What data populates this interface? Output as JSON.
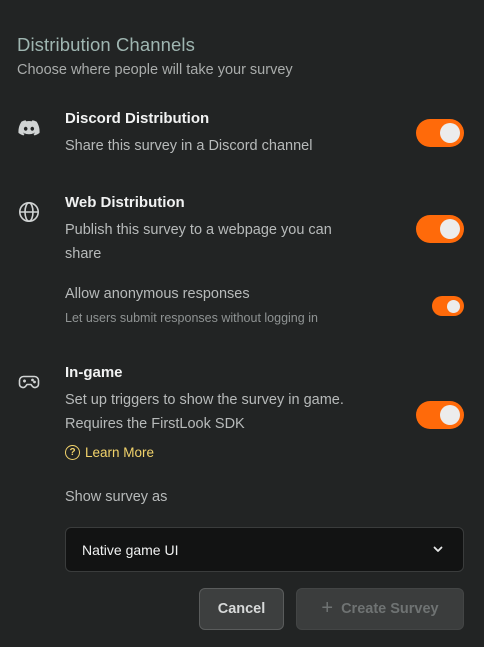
{
  "header": {
    "title": "Distribution Channels",
    "subtitle": "Choose where people will take your survey"
  },
  "discord": {
    "icon": "discord-icon",
    "title": "Discord Distribution",
    "description": "Share this survey in a Discord channel",
    "enabled": true
  },
  "web": {
    "icon": "globe-icon",
    "title": "Web Distribution",
    "description": "Publish this survey to a webpage you can share",
    "enabled": true,
    "anonymous": {
      "label": "Allow anonymous responses",
      "description": "Let users submit responses without logging in",
      "enabled": true
    }
  },
  "ingame": {
    "icon": "gamepad-icon",
    "title": "In-game",
    "description": "Set up triggers to show the survey in game. Requires the FirstLook SDK",
    "enabled": true,
    "learn_more": "Learn More",
    "show_as_label": "Show survey as",
    "show_as_value": "Native game UI"
  },
  "actions": {
    "cancel": "Cancel",
    "create": "Create Survey"
  },
  "colors": {
    "accent": "#ff6a0a",
    "link": "#f2d36b",
    "background": "#222424"
  }
}
